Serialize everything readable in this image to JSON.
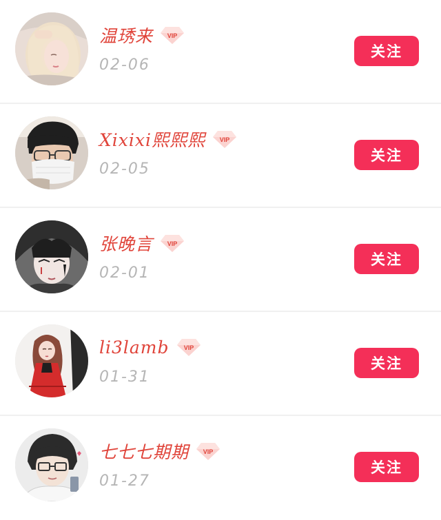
{
  "follow_list": {
    "items": [
      {
        "name": "温琇来",
        "date": "02-06",
        "follow_label": "关注",
        "vip_label": "VIP",
        "avatar": "avatar-blonde-girl"
      },
      {
        "name": "Xixixi熙熙熙",
        "date": "02-05",
        "follow_label": "关注",
        "vip_label": "VIP",
        "avatar": "avatar-boy-with-mask"
      },
      {
        "name": "张晚言",
        "date": "02-01",
        "follow_label": "关注",
        "vip_label": "VIP",
        "avatar": "avatar-anime-boy"
      },
      {
        "name": "li3lamb",
        "date": "01-31",
        "follow_label": "关注",
        "vip_label": "VIP",
        "avatar": "avatar-anime-girl-red-dress"
      },
      {
        "name": "七七七期期",
        "date": "01-27",
        "follow_label": "关注",
        "vip_label": "VIP",
        "avatar": "avatar-anime-boy-glasses"
      }
    ]
  },
  "colors": {
    "accent": "#f42f58",
    "name": "#e0443a",
    "date": "#b5b5b5",
    "divider": "#f0f0f0"
  }
}
